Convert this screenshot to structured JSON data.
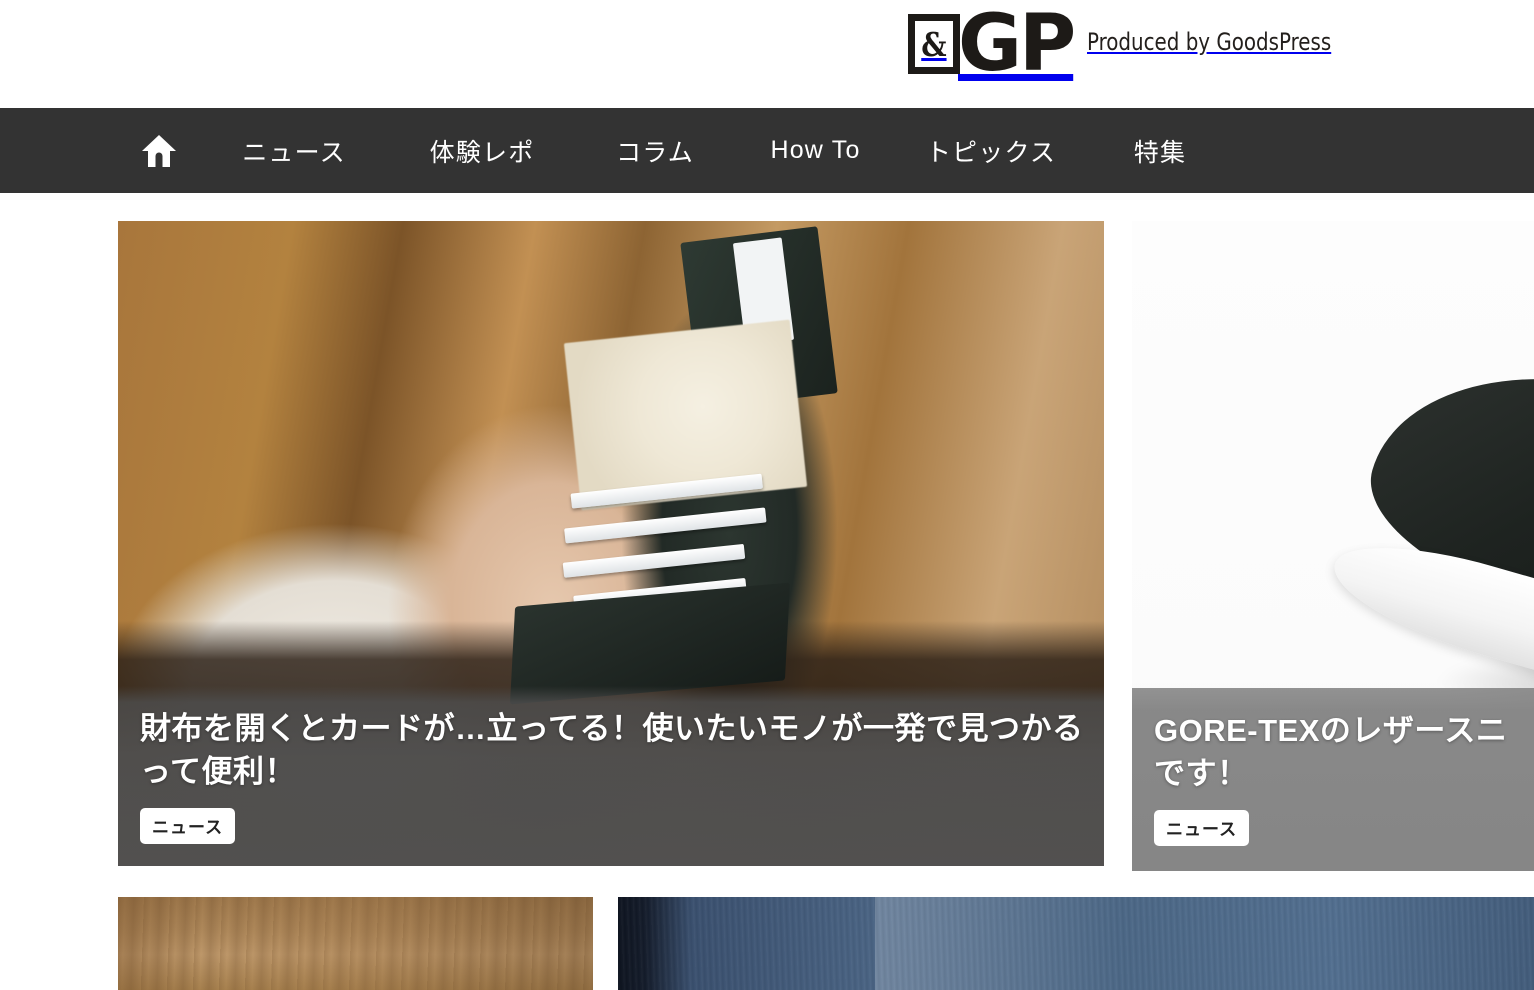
{
  "header": {
    "logo_mark": "&",
    "logo_text": "GP",
    "logo_tagline": "Produced by GoodsPress"
  },
  "nav": {
    "items": [
      {
        "label": "",
        "icon": "home-icon",
        "name": "home"
      },
      {
        "label": "ニュース",
        "name": "news"
      },
      {
        "label": "体験レポ",
        "name": "taiken-repo"
      },
      {
        "label": "コラム",
        "name": "column"
      },
      {
        "label": "How To",
        "name": "how-to"
      },
      {
        "label": "トピックス",
        "name": "topics"
      },
      {
        "label": "特集",
        "name": "feature"
      }
    ],
    "background_color": "#333333",
    "text_color": "#ffffff"
  },
  "cards": [
    {
      "title": "財布を開くとカードが…立ってる！使いたいモノが一発で見つかるって便利！",
      "badge": "ニュース",
      "photo": "hand-holding-open-leather-wallet-with-banknote-and-cards"
    },
    {
      "title": "GORE-TEXのレザースニ",
      "title_line2": "です！",
      "badge": "ニュース",
      "photo": "black-leather-sneaker-on-white-background"
    }
  ],
  "thumbnails": [
    {
      "name": "thumb-wood",
      "description": "wood-grain-surface"
    },
    {
      "name": "thumb-denim",
      "description": "dark-blue-denim-fabric"
    }
  ]
}
